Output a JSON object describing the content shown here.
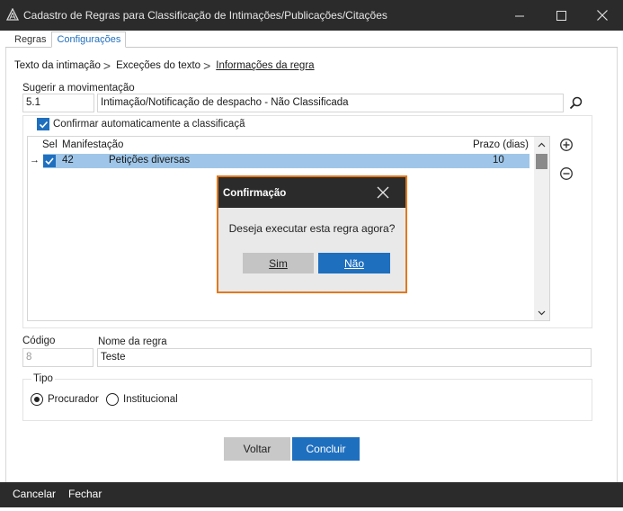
{
  "window": {
    "title": "Cadastro de Regras para Classificação de Intimações/Publicações/Citações",
    "icons": [
      "app-logo-icon",
      "minimize-icon",
      "maximize-icon",
      "close-icon"
    ]
  },
  "tabs": [
    {
      "label": "Regras"
    },
    {
      "label": "Configurações",
      "active": true
    }
  ],
  "breadcrumb": {
    "step1": "Texto da intimação",
    "step2": "Exceções do texto",
    "step3": "Informações da regra",
    "separator": ">"
  },
  "movement": {
    "label": "Sugerir a movimentação",
    "code": "5.1",
    "description": "Intimação/Notificação de despacho - Não Classificada"
  },
  "auto_confirm": {
    "label": "Confirmar automaticamente a classificação",
    "checked": true
  },
  "grid": {
    "columns": {
      "sel": "Sel",
      "manifestacao": "Manifestação",
      "prazo": "Prazo (dias)"
    },
    "rows": [
      {
        "pointer": "→",
        "selected": true,
        "code": "42",
        "name": "Petições diversas",
        "prazo": "10"
      }
    ]
  },
  "fields": {
    "codigo_label": "Código",
    "codigo_value": "8",
    "nome_label": "Nome da regra",
    "nome_value": "Teste"
  },
  "tipo": {
    "label": "Tipo",
    "options": [
      {
        "label": "Procurador",
        "checked": true
      },
      {
        "label": "Institucional",
        "checked": false
      }
    ]
  },
  "buttons": {
    "voltar": "Voltar",
    "concluir": "Concluir"
  },
  "statusbar": {
    "cancelar": "Cancelar",
    "fechar": "Fechar"
  },
  "dialog": {
    "title": "Confirmação",
    "message": "Deseja executar esta regra agora?",
    "yes": "Sim",
    "no": "Não"
  },
  "colors": {
    "accent": "#1f6fbf",
    "titlebar": "#2b2b2b",
    "dialog_border": "#e07a1f",
    "selected_row": "#9fc6e8"
  }
}
